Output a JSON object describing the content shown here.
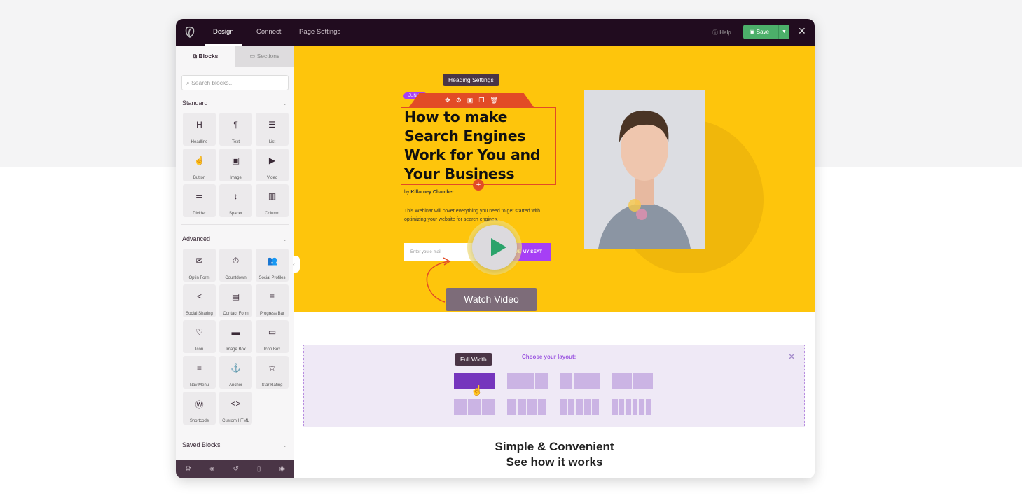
{
  "topbar": {
    "tabs": [
      "Design",
      "Connect",
      "Page Settings"
    ],
    "help": "Help",
    "save": "Save"
  },
  "sidebar": {
    "tabs": [
      "Blocks",
      "Sections"
    ],
    "search_placeholder": "Search blocks...",
    "standard_title": "Standard",
    "standard": [
      {
        "label": "Headline",
        "icon": "H"
      },
      {
        "label": "Text",
        "icon": "¶"
      },
      {
        "label": "List",
        "icon": "☰"
      },
      {
        "label": "Button",
        "icon": "☝"
      },
      {
        "label": "Image",
        "icon": "▣"
      },
      {
        "label": "Video",
        "icon": "▶"
      },
      {
        "label": "Divider",
        "icon": "═"
      },
      {
        "label": "Spacer",
        "icon": "↕"
      },
      {
        "label": "Column",
        "icon": "▥"
      }
    ],
    "advanced_title": "Advanced",
    "advanced": [
      {
        "label": "Optin Form",
        "icon": "✉"
      },
      {
        "label": "Countdown",
        "icon": "⏱"
      },
      {
        "label": "Social Profiles",
        "icon": "👥"
      },
      {
        "label": "Social Sharing",
        "icon": "<"
      },
      {
        "label": "Contact Form",
        "icon": "▤"
      },
      {
        "label": "Progress Bar",
        "icon": "≡"
      },
      {
        "label": "Icon",
        "icon": "♡"
      },
      {
        "label": "Image Box",
        "icon": "▬"
      },
      {
        "label": "Icon Box",
        "icon": "▭"
      },
      {
        "label": "Nav Menu",
        "icon": "≡"
      },
      {
        "label": "Anchor",
        "icon": "⚓"
      },
      {
        "label": "Star Rating",
        "icon": "☆"
      },
      {
        "label": "Shortcode",
        "icon": "Ⓦ"
      },
      {
        "label": "Custom HTML",
        "icon": "<>"
      }
    ],
    "saved_title": "Saved Blocks",
    "footer_icons": [
      "settings-icon",
      "layers-icon",
      "history-icon",
      "mobile-icon",
      "preview-icon"
    ]
  },
  "hero": {
    "tooltip": "Heading Settings",
    "badge": "JUN 19",
    "heading": "How to make Search Engines Work for You and Your Business",
    "by_prefix": "by",
    "author": "Killarney Chamber",
    "description": "This Webinar will cover everything you need to get started with optimizing your website for search engines.",
    "email_placeholder": "Enter you e-mail",
    "cta": "SAVE MY SEAT",
    "watch": "Watch Video"
  },
  "layout": {
    "tooltip": "Full Width",
    "title": "Choose your layout:"
  },
  "section": {
    "line1": "Simple & Convenient",
    "line2": "See how it works"
  },
  "colors": {
    "topbar": "#210c1f",
    "hero": "#fec50c",
    "accent": "#a63ff5",
    "save": "#4caf6a",
    "selection": "#e24b26"
  }
}
